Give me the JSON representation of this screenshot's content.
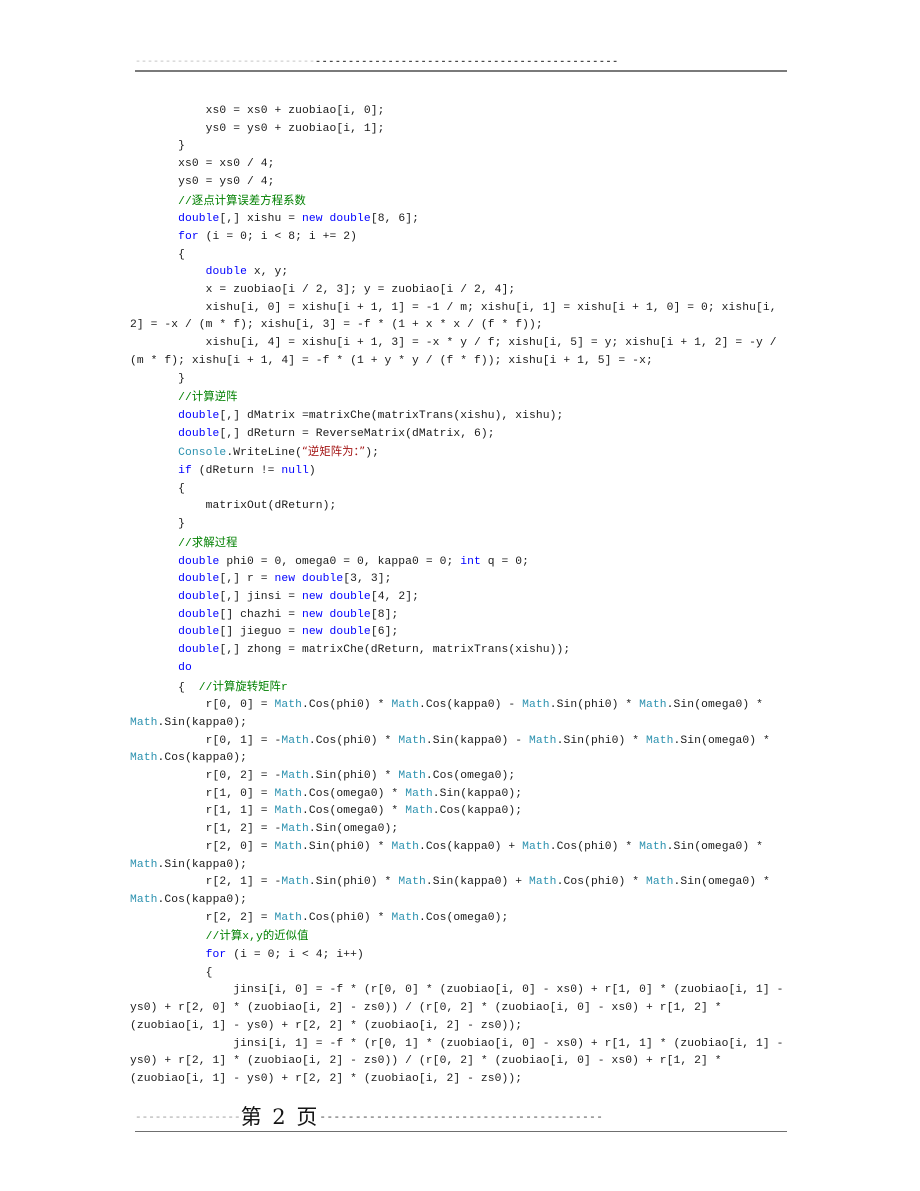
{
  "document": {
    "page_label": "第 2 页",
    "header": {
      "dash_light": "------------------------------",
      "dash_dark": "----------------------------------------------"
    },
    "footer": {
      "dash_left": "----------------",
      "dash_right": "----------------------------------------"
    }
  },
  "colors": {
    "keyword": "#0000ff",
    "comment": "#008000",
    "string": "#a31515",
    "class": "#2b91af",
    "text": "#1a1a1a",
    "rule": "#7a7a7a"
  },
  "code": {
    "language": "csharp",
    "lines": [
      {
        "id": "l01",
        "indent": 11,
        "segments": [
          {
            "t": "xs0 = xs0 + zuobiao[i, 0];",
            "c": "plain"
          }
        ]
      },
      {
        "id": "l02",
        "indent": 11,
        "segments": [
          {
            "t": "ys0 = ys0 + zuobiao[i, 1];",
            "c": "plain"
          }
        ]
      },
      {
        "id": "l03",
        "indent": 7,
        "segments": [
          {
            "t": "}",
            "c": "plain"
          }
        ]
      },
      {
        "id": "l04",
        "indent": 7,
        "segments": [
          {
            "t": "xs0 = xs0 / 4;",
            "c": "plain"
          }
        ]
      },
      {
        "id": "l05",
        "indent": 7,
        "segments": [
          {
            "t": "ys0 = ys0 / 4;",
            "c": "plain"
          }
        ]
      },
      {
        "id": "l06",
        "indent": 7,
        "segments": [
          {
            "t": "//逐点计算误差方程系数",
            "c": "cmt"
          }
        ]
      },
      {
        "id": "l07",
        "indent": 7,
        "segments": [
          {
            "t": "double",
            "c": "kw"
          },
          {
            "t": "[,] xishu = ",
            "c": "plain"
          },
          {
            "t": "new",
            "c": "kw"
          },
          {
            "t": " ",
            "c": "plain"
          },
          {
            "t": "double",
            "c": "kw"
          },
          {
            "t": "[8, 6];",
            "c": "plain"
          }
        ]
      },
      {
        "id": "l08",
        "indent": 7,
        "segments": [
          {
            "t": "for",
            "c": "kw"
          },
          {
            "t": " (i = 0; i < 8; i += 2)",
            "c": "plain"
          }
        ]
      },
      {
        "id": "l09",
        "indent": 7,
        "segments": [
          {
            "t": "{",
            "c": "plain"
          }
        ]
      },
      {
        "id": "l10",
        "indent": 11,
        "segments": [
          {
            "t": "double",
            "c": "kw"
          },
          {
            "t": " x, y;",
            "c": "plain"
          }
        ]
      },
      {
        "id": "l11",
        "indent": 11,
        "segments": [
          {
            "t": "x = zuobiao[i / 2, 3]; y = zuobiao[i / 2, 4];",
            "c": "plain"
          }
        ]
      },
      {
        "id": "l12",
        "indent": 11,
        "segments": [
          {
            "t": "xishu[i, 0] = xishu[i + 1, 1] = -1 / m; xishu[i, 1] = xishu[i + 1, 0] = 0; xishu[i, 2] = -x / (m * f); xishu[i, 3] = -f * (1 + x * x / (f * f));",
            "c": "plain"
          }
        ]
      },
      {
        "id": "l13",
        "indent": 11,
        "segments": [
          {
            "t": "xishu[i, 4] = xishu[i + 1, 3] = -x * y / f; xishu[i, 5] = y; xishu[i + 1, 2] = -y / (m * f); xishu[i + 1, 4] = -f * (1 + y * y / (f * f)); xishu[i + 1, 5] = -x;",
            "c": "plain"
          }
        ]
      },
      {
        "id": "l14",
        "indent": 7,
        "segments": [
          {
            "t": "}",
            "c": "plain"
          }
        ]
      },
      {
        "id": "l15",
        "indent": 7,
        "segments": [
          {
            "t": "//计算逆阵",
            "c": "cmt"
          }
        ]
      },
      {
        "id": "l16",
        "indent": 7,
        "segments": [
          {
            "t": "double",
            "c": "kw"
          },
          {
            "t": "[,] dMatrix =matrixChe(matrixTrans(xishu), xishu);",
            "c": "plain"
          }
        ]
      },
      {
        "id": "l17",
        "indent": 7,
        "segments": [
          {
            "t": "double",
            "c": "kw"
          },
          {
            "t": "[,] dReturn = ReverseMatrix(dMatrix, 6);",
            "c": "plain"
          }
        ]
      },
      {
        "id": "l18",
        "indent": 7,
        "segments": [
          {
            "t": "Console",
            "c": "cls"
          },
          {
            "t": ".WriteLine(",
            "c": "plain"
          },
          {
            "t": "“逆矩阵为：”",
            "c": "str"
          },
          {
            "t": ");",
            "c": "plain"
          }
        ]
      },
      {
        "id": "l19",
        "indent": 7,
        "segments": [
          {
            "t": "if",
            "c": "kw"
          },
          {
            "t": " (dReturn != ",
            "c": "plain"
          },
          {
            "t": "null",
            "c": "kw"
          },
          {
            "t": ")",
            "c": "plain"
          }
        ]
      },
      {
        "id": "l20",
        "indent": 7,
        "segments": [
          {
            "t": "{",
            "c": "plain"
          }
        ]
      },
      {
        "id": "l21",
        "indent": 11,
        "segments": [
          {
            "t": "matrixOut(dReturn);",
            "c": "plain"
          }
        ]
      },
      {
        "id": "l22",
        "indent": 7,
        "segments": [
          {
            "t": "}",
            "c": "plain"
          }
        ]
      },
      {
        "id": "l23",
        "indent": 7,
        "segments": [
          {
            "t": "//求解过程",
            "c": "cmt"
          }
        ]
      },
      {
        "id": "l24",
        "indent": 7,
        "segments": [
          {
            "t": "double",
            "c": "kw"
          },
          {
            "t": " phi0 = 0, omega0 = 0, kappa0 = 0; ",
            "c": "plain"
          },
          {
            "t": "int",
            "c": "kw"
          },
          {
            "t": " q = 0;",
            "c": "plain"
          }
        ]
      },
      {
        "id": "l25",
        "indent": 7,
        "segments": [
          {
            "t": "double",
            "c": "kw"
          },
          {
            "t": "[,] r = ",
            "c": "plain"
          },
          {
            "t": "new",
            "c": "kw"
          },
          {
            "t": " ",
            "c": "plain"
          },
          {
            "t": "double",
            "c": "kw"
          },
          {
            "t": "[3, 3];",
            "c": "plain"
          }
        ]
      },
      {
        "id": "l26",
        "indent": 7,
        "segments": [
          {
            "t": "double",
            "c": "kw"
          },
          {
            "t": "[,] jinsi = ",
            "c": "plain"
          },
          {
            "t": "new",
            "c": "kw"
          },
          {
            "t": " ",
            "c": "plain"
          },
          {
            "t": "double",
            "c": "kw"
          },
          {
            "t": "[4, 2];",
            "c": "plain"
          }
        ]
      },
      {
        "id": "l27",
        "indent": 7,
        "segments": [
          {
            "t": "double",
            "c": "kw"
          },
          {
            "t": "[] chazhi = ",
            "c": "plain"
          },
          {
            "t": "new",
            "c": "kw"
          },
          {
            "t": " ",
            "c": "plain"
          },
          {
            "t": "double",
            "c": "kw"
          },
          {
            "t": "[8];",
            "c": "plain"
          }
        ]
      },
      {
        "id": "l28",
        "indent": 7,
        "segments": [
          {
            "t": "double",
            "c": "kw"
          },
          {
            "t": "[] jieguo = ",
            "c": "plain"
          },
          {
            "t": "new",
            "c": "kw"
          },
          {
            "t": " ",
            "c": "plain"
          },
          {
            "t": "double",
            "c": "kw"
          },
          {
            "t": "[6];",
            "c": "plain"
          }
        ]
      },
      {
        "id": "l29",
        "indent": 7,
        "segments": [
          {
            "t": "double",
            "c": "kw"
          },
          {
            "t": "[,] zhong = matrixChe(dReturn, matrixTrans(xishu));",
            "c": "plain"
          }
        ]
      },
      {
        "id": "l30",
        "indent": 7,
        "segments": [
          {
            "t": "do",
            "c": "kw"
          }
        ]
      },
      {
        "id": "l31",
        "indent": 7,
        "segments": [
          {
            "t": "{  ",
            "c": "plain"
          },
          {
            "t": "//计算旋转矩阵r",
            "c": "cmt"
          }
        ]
      },
      {
        "id": "l32",
        "indent": 11,
        "segments": [
          {
            "t": "r[0, 0] = ",
            "c": "plain"
          },
          {
            "t": "Math",
            "c": "cls"
          },
          {
            "t": ".Cos(phi0) * ",
            "c": "plain"
          },
          {
            "t": "Math",
            "c": "cls"
          },
          {
            "t": ".Cos(kappa0) - ",
            "c": "plain"
          },
          {
            "t": "Math",
            "c": "cls"
          },
          {
            "t": ".Sin(phi0) * ",
            "c": "plain"
          },
          {
            "t": "Math",
            "c": "cls"
          },
          {
            "t": ".Sin(omega0) * ",
            "c": "plain"
          },
          {
            "t": "Math",
            "c": "cls"
          },
          {
            "t": ".Sin(kappa0);",
            "c": "plain"
          }
        ]
      },
      {
        "id": "l33",
        "indent": 11,
        "segments": [
          {
            "t": "r[0, 1] = -",
            "c": "plain"
          },
          {
            "t": "Math",
            "c": "cls"
          },
          {
            "t": ".Cos(phi0) * ",
            "c": "plain"
          },
          {
            "t": "Math",
            "c": "cls"
          },
          {
            "t": ".Sin(kappa0) - ",
            "c": "plain"
          },
          {
            "t": "Math",
            "c": "cls"
          },
          {
            "t": ".Sin(phi0) * ",
            "c": "plain"
          },
          {
            "t": "Math",
            "c": "cls"
          },
          {
            "t": ".Sin(omega0) * ",
            "c": "plain"
          },
          {
            "t": "Math",
            "c": "cls"
          },
          {
            "t": ".Cos(kappa0);",
            "c": "plain"
          }
        ]
      },
      {
        "id": "l34",
        "indent": 11,
        "segments": [
          {
            "t": "r[0, 2] = -",
            "c": "plain"
          },
          {
            "t": "Math",
            "c": "cls"
          },
          {
            "t": ".Sin(phi0) * ",
            "c": "plain"
          },
          {
            "t": "Math",
            "c": "cls"
          },
          {
            "t": ".Cos(omega0);",
            "c": "plain"
          }
        ]
      },
      {
        "id": "l35",
        "indent": 11,
        "segments": [
          {
            "t": "r[1, 0] = ",
            "c": "plain"
          },
          {
            "t": "Math",
            "c": "cls"
          },
          {
            "t": ".Cos(omega0) * ",
            "c": "plain"
          },
          {
            "t": "Math",
            "c": "cls"
          },
          {
            "t": ".Sin(kappa0);",
            "c": "plain"
          }
        ]
      },
      {
        "id": "l36",
        "indent": 11,
        "segments": [
          {
            "t": "r[1, 1] = ",
            "c": "plain"
          },
          {
            "t": "Math",
            "c": "cls"
          },
          {
            "t": ".Cos(omega0) * ",
            "c": "plain"
          },
          {
            "t": "Math",
            "c": "cls"
          },
          {
            "t": ".Cos(kappa0);",
            "c": "plain"
          }
        ]
      },
      {
        "id": "l37",
        "indent": 11,
        "segments": [
          {
            "t": "r[1, 2] = -",
            "c": "plain"
          },
          {
            "t": "Math",
            "c": "cls"
          },
          {
            "t": ".Sin(omega0);",
            "c": "plain"
          }
        ]
      },
      {
        "id": "l38",
        "indent": 11,
        "segments": [
          {
            "t": "r[2, 0] = ",
            "c": "plain"
          },
          {
            "t": "Math",
            "c": "cls"
          },
          {
            "t": ".Sin(phi0) * ",
            "c": "plain"
          },
          {
            "t": "Math",
            "c": "cls"
          },
          {
            "t": ".Cos(kappa0) + ",
            "c": "plain"
          },
          {
            "t": "Math",
            "c": "cls"
          },
          {
            "t": ".Cos(phi0) * ",
            "c": "plain"
          },
          {
            "t": "Math",
            "c": "cls"
          },
          {
            "t": ".Sin(omega0) * ",
            "c": "plain"
          },
          {
            "t": "Math",
            "c": "cls"
          },
          {
            "t": ".Sin(kappa0);",
            "c": "plain"
          }
        ]
      },
      {
        "id": "l39",
        "indent": 11,
        "segments": [
          {
            "t": "r[2, 1] = -",
            "c": "plain"
          },
          {
            "t": "Math",
            "c": "cls"
          },
          {
            "t": ".Sin(phi0) * ",
            "c": "plain"
          },
          {
            "t": "Math",
            "c": "cls"
          },
          {
            "t": ".Sin(kappa0) + ",
            "c": "plain"
          },
          {
            "t": "Math",
            "c": "cls"
          },
          {
            "t": ".Cos(phi0) * ",
            "c": "plain"
          },
          {
            "t": "Math",
            "c": "cls"
          },
          {
            "t": ".Sin(omega0) * ",
            "c": "plain"
          },
          {
            "t": "Math",
            "c": "cls"
          },
          {
            "t": ".Cos(kappa0);",
            "c": "plain"
          }
        ]
      },
      {
        "id": "l40",
        "indent": 11,
        "segments": [
          {
            "t": "r[2, 2] = ",
            "c": "plain"
          },
          {
            "t": "Math",
            "c": "cls"
          },
          {
            "t": ".Cos(phi0) * ",
            "c": "plain"
          },
          {
            "t": "Math",
            "c": "cls"
          },
          {
            "t": ".Cos(omega0);",
            "c": "plain"
          }
        ]
      },
      {
        "id": "l41",
        "indent": 11,
        "segments": [
          {
            "t": "//计算x,y的近似值",
            "c": "cmt"
          }
        ]
      },
      {
        "id": "l42",
        "indent": 11,
        "segments": [
          {
            "t": "for",
            "c": "kw"
          },
          {
            "t": " (i = 0; i < 4; i++)",
            "c": "plain"
          }
        ]
      },
      {
        "id": "l43",
        "indent": 11,
        "segments": [
          {
            "t": "{",
            "c": "plain"
          }
        ]
      },
      {
        "id": "l44",
        "indent": 15,
        "segments": [
          {
            "t": "jinsi[i, 0] = -f * (r[0, 0] * (zuobiao[i, 0] - xs0) + r[1, 0] * (zuobiao[i, 1] - ys0) + r[2, 0] * (zuobiao[i, 2] - zs0)) / (r[0, 2] * (zuobiao[i, 0] - xs0) + r[1, 2] * (zuobiao[i, 1] - ys0) + r[2, 2] * (zuobiao[i, 2] - zs0));",
            "c": "plain"
          }
        ]
      },
      {
        "id": "l45",
        "indent": 15,
        "segments": [
          {
            "t": "jinsi[i, 1] = -f * (r[0, 1] * (zuobiao[i, 0] - xs0) + r[1, 1] * (zuobiao[i, 1] - ys0) + r[2, 1] * (zuobiao[i, 2] - zs0)) / (r[0, 2] * (zuobiao[i, 0] - xs0) + r[1, 2] * (zuobiao[i, 1] - ys0) + r[2, 2] * (zuobiao[i, 2] - zs0));",
            "c": "plain"
          }
        ]
      }
    ]
  }
}
